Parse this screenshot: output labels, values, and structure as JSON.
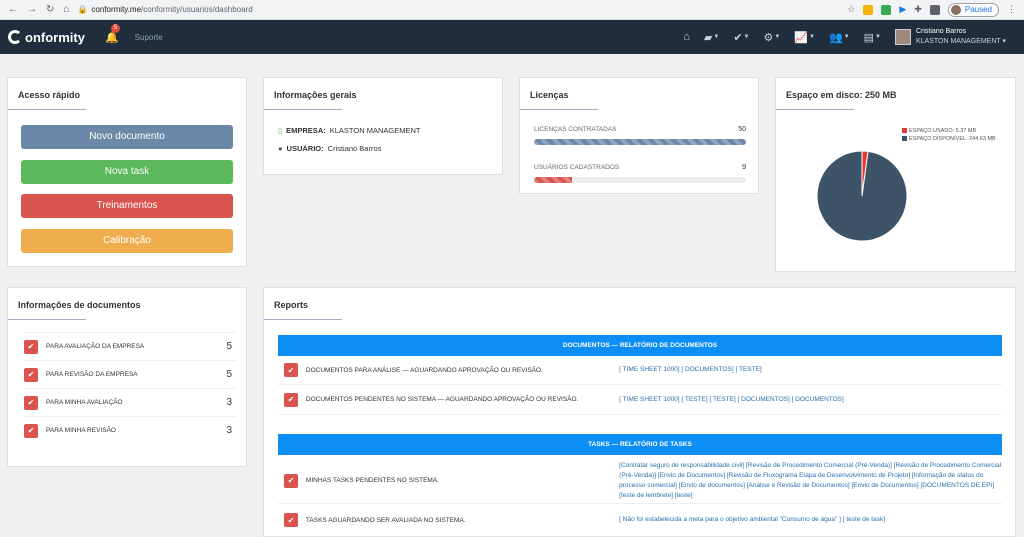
{
  "browser": {
    "url_domain": "conformity.me",
    "url_path": "/conformity/usuarios/dashboard",
    "paused_label": "Paused"
  },
  "header": {
    "brand": "onformity",
    "notification_count": "5",
    "support_label": "Suporte",
    "user_name": "Cristiano Barros",
    "company": "KLASTON MANAGEMENT"
  },
  "quick_access": {
    "title": "Acesso rápido",
    "buttons": [
      {
        "label": "Novo documento",
        "color": "#6b88a8"
      },
      {
        "label": "Nova task",
        "color": "#5cb85c"
      },
      {
        "label": "Treinamentos",
        "color": "#d9534f"
      },
      {
        "label": "Calibração",
        "color": "#f0ad4e"
      }
    ]
  },
  "general_info": {
    "title": "Informações gerais",
    "company_label": "EMPRESA:",
    "company_value": "KLASTON MANAGEMENT",
    "user_label": "USUÁRIO:",
    "user_value": "Cristiano Barros"
  },
  "licenses": {
    "title": "Licenças",
    "contracted_label": "LICENÇAS CONTRATADAS",
    "contracted_value": "50",
    "contracted_fraction": 1.0,
    "registered_label": "USUÁRIOS CADASTRADOS",
    "registered_value": "9",
    "registered_fraction": 0.18
  },
  "disk": {
    "title": "Espaço em disco: 250 MB",
    "used_label": "ESPAÇO USADO: 5.37 MB",
    "free_label": "ESPAÇO DISPONÍVEL: 244.63 MB",
    "used_color": "#e53935",
    "free_color": "#3d5468"
  },
  "chart_data": {
    "type": "pie",
    "categories": [
      "ESPAÇO USADO",
      "ESPAÇO DISPONÍVEL"
    ],
    "values": [
      5.37,
      244.63
    ],
    "legend": "top-right"
  },
  "doc_info": {
    "title": "Informações de documentos",
    "rows": [
      {
        "label": "PARA AVALIAÇÃO DA EMPRESA",
        "count": "5"
      },
      {
        "label": "PARA REVISÃO DA EMPRESA",
        "count": "5"
      },
      {
        "label": "PARA MINHA AVALIAÇÃO",
        "count": "3"
      },
      {
        "label": "PARA MINHA REVISÃO",
        "count": "3"
      }
    ]
  },
  "reports": {
    "title": "Reports",
    "docs_header": "DOCUMENTOS — RELATÓRIO DE DOCUMENTOS",
    "docs_rows": [
      {
        "desc": "DOCUMENTOS PARA ANÁLISE — AGUARDANDO APROVAÇÃO OU REVISÃO.",
        "links": "[ TIME SHEET 1000]  [ DOCUMENTOS]  [ TESTE]"
      },
      {
        "desc": "DOCUMENTOS PENDENTES NO SISTEMA — AGUARDANDO APROVAÇÃO OU REVISÃO.",
        "links": "[ TIME SHEET 1000]  [ TESTE]  [ TESTE]  [ DOCUMENTOS]  [ DOCUMENTOS]"
      }
    ],
    "tasks_header": "TASKS — RELATÓRIO DE TASKS",
    "tasks_rows": [
      {
        "desc": "MINHAS TASKS PENDENTES NO SISTEMA.",
        "links": "[Contratar seguro de responsabilidade civil]  [Revisão de Procedimento Comercial (Pré-Venda)]  [Revisão de Procedimento Comercial (Pré-Venda)]  [Envio de Documentos]  [Revisão de Fluxograma Etapa de Desenvolvimento de Projeto]  [Informação de status do processo comercial]  [Envio de documentos]  [Análise e Revisão de Documentos]  [Envio de Documentos]  [DOCUMENTOS DE EPI]  [teste de lembrete]  [teste]"
      },
      {
        "desc": "TASKS AGUARDANDO SER AVALIADA NO SISTEMA.",
        "links": "[ Não foi estabelecida a meta para o objetivo ambiental \"Consumo de água\" ]  [ teste de task]"
      }
    ]
  }
}
